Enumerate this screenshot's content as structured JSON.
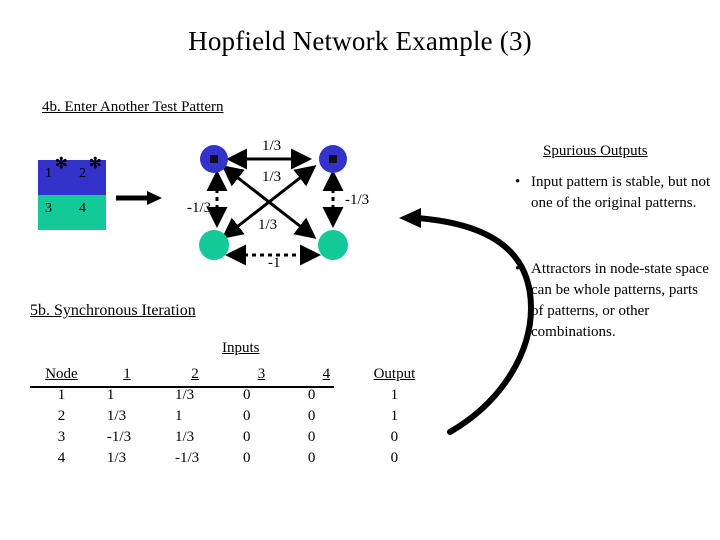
{
  "slide": {
    "title": "Hopfield Network Example (3)",
    "headings": {
      "step_4b": "4b. Enter Another Test Pattern",
      "step_5b": "5b. Synchronous Iteration"
    }
  },
  "pattern_grid": {
    "cells": [
      {
        "label": "1",
        "state": "on",
        "star": "✻"
      },
      {
        "label": "2",
        "state": "on",
        "star": "✻"
      },
      {
        "label": "3",
        "state": "off",
        "star": ""
      },
      {
        "label": "4",
        "state": "off",
        "star": ""
      }
    ],
    "colors": {
      "on": "#3333cc",
      "off": "#13c998"
    }
  },
  "network": {
    "nodes": [
      {
        "id": "n1",
        "position": "top-left",
        "color": "#3333cc",
        "marker": "star"
      },
      {
        "id": "n2",
        "position": "top-right",
        "color": "#3333cc",
        "marker": "star"
      },
      {
        "id": "n3",
        "position": "bottom-left",
        "color": "#13c998",
        "marker": "none"
      },
      {
        "id": "n4",
        "position": "bottom-right",
        "color": "#13c998",
        "marker": "none"
      }
    ],
    "edges": [
      {
        "from": "n1",
        "to": "n2",
        "weight": "1/3",
        "style": "solid"
      },
      {
        "from": "n1",
        "to": "n4",
        "weight": "1/3",
        "style": "solid"
      },
      {
        "from": "n2",
        "to": "n3",
        "weight": "1/3",
        "style": "solid"
      },
      {
        "from": "n1",
        "to": "n3",
        "weight": "-1/3",
        "style": "dotted"
      },
      {
        "from": "n2",
        "to": "n4",
        "weight": "-1/3",
        "style": "dotted"
      },
      {
        "from": "n3",
        "to": "n4",
        "weight": "-1",
        "style": "dotted"
      }
    ],
    "labels": {
      "top": "1/3",
      "cross_upper": "1/3",
      "left": "-1/3",
      "right": "-1/3",
      "cross_lower": "1/3",
      "bottom": "-1"
    }
  },
  "iteration_table": {
    "caption": "Inputs",
    "columns": {
      "node": "Node",
      "inputs": [
        "1",
        "2",
        "3",
        "4"
      ],
      "output": "Output"
    },
    "rows": [
      {
        "node": "1",
        "inputs": [
          "1",
          "1/3",
          "0",
          "0"
        ],
        "output": "1"
      },
      {
        "node": "2",
        "inputs": [
          "1/3",
          "1",
          "0",
          "0"
        ],
        "output": "1"
      },
      {
        "node": "3",
        "inputs": [
          "-1/3",
          "1/3",
          "0",
          "0"
        ],
        "output": "0"
      },
      {
        "node": "4",
        "inputs": [
          "1/3",
          "-1/3",
          "0",
          "0"
        ],
        "output": "0"
      }
    ]
  },
  "notes": {
    "heading": "Spurious Outputs",
    "bullet_marker": "•",
    "bullets": [
      "Input pattern is stable, but not one of the original patterns.",
      "Attractors in node-state space can be whole patterns, parts of patterns, or other combinations."
    ]
  }
}
